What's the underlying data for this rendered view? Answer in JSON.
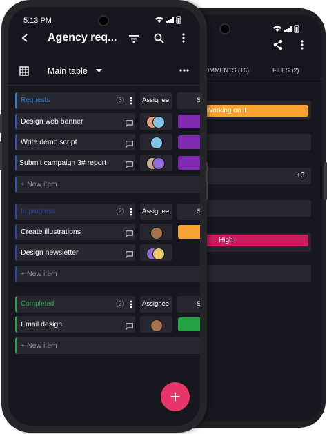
{
  "status_bar": {
    "time": "5:13 PM"
  },
  "back_phone": {
    "tabs": {
      "comments": "COMMENTS (16)",
      "files": "FILES (2)"
    },
    "status_value": "Working on it",
    "more_count": "+3",
    "priority_value": "High",
    "colors": {
      "status": "#f7a233",
      "priority": "#cc1d5e"
    }
  },
  "header": {
    "title": "Agency req..."
  },
  "toolbar": {
    "view_label": "Main table"
  },
  "groups": [
    {
      "name": "Requests",
      "count": "(3)",
      "color": "#2f7fd6",
      "assignee_header": "Assignee",
      "status_header_fragment": "S",
      "items": [
        {
          "label": "Design web banner",
          "status_color": "#7e2ab0"
        },
        {
          "label": "Write demo script",
          "status_color": "#7e2ab0"
        },
        {
          "label": "Submit campaign 3# report",
          "status_color": "#7e2ab0"
        }
      ],
      "new_item": "+ New item"
    },
    {
      "name": "In progress",
      "count": "(2)",
      "color": "#2a49a8",
      "assignee_header": "Assignee",
      "status_header_fragment": "S",
      "items": [
        {
          "label": "Create illustrations",
          "status_color": "#f7a233"
        },
        {
          "label": "Design newsletter",
          "status_color": ""
        }
      ],
      "new_item": "+ New item"
    },
    {
      "name": "Completed",
      "count": "(2)",
      "color": "#2aa648",
      "assignee_header": "Assignee",
      "status_header_fragment": "S",
      "items": [
        {
          "label": "Email design",
          "status_color": "#25a244"
        }
      ],
      "new_item": "+ New item"
    }
  ],
  "fab": {
    "label": "+"
  }
}
